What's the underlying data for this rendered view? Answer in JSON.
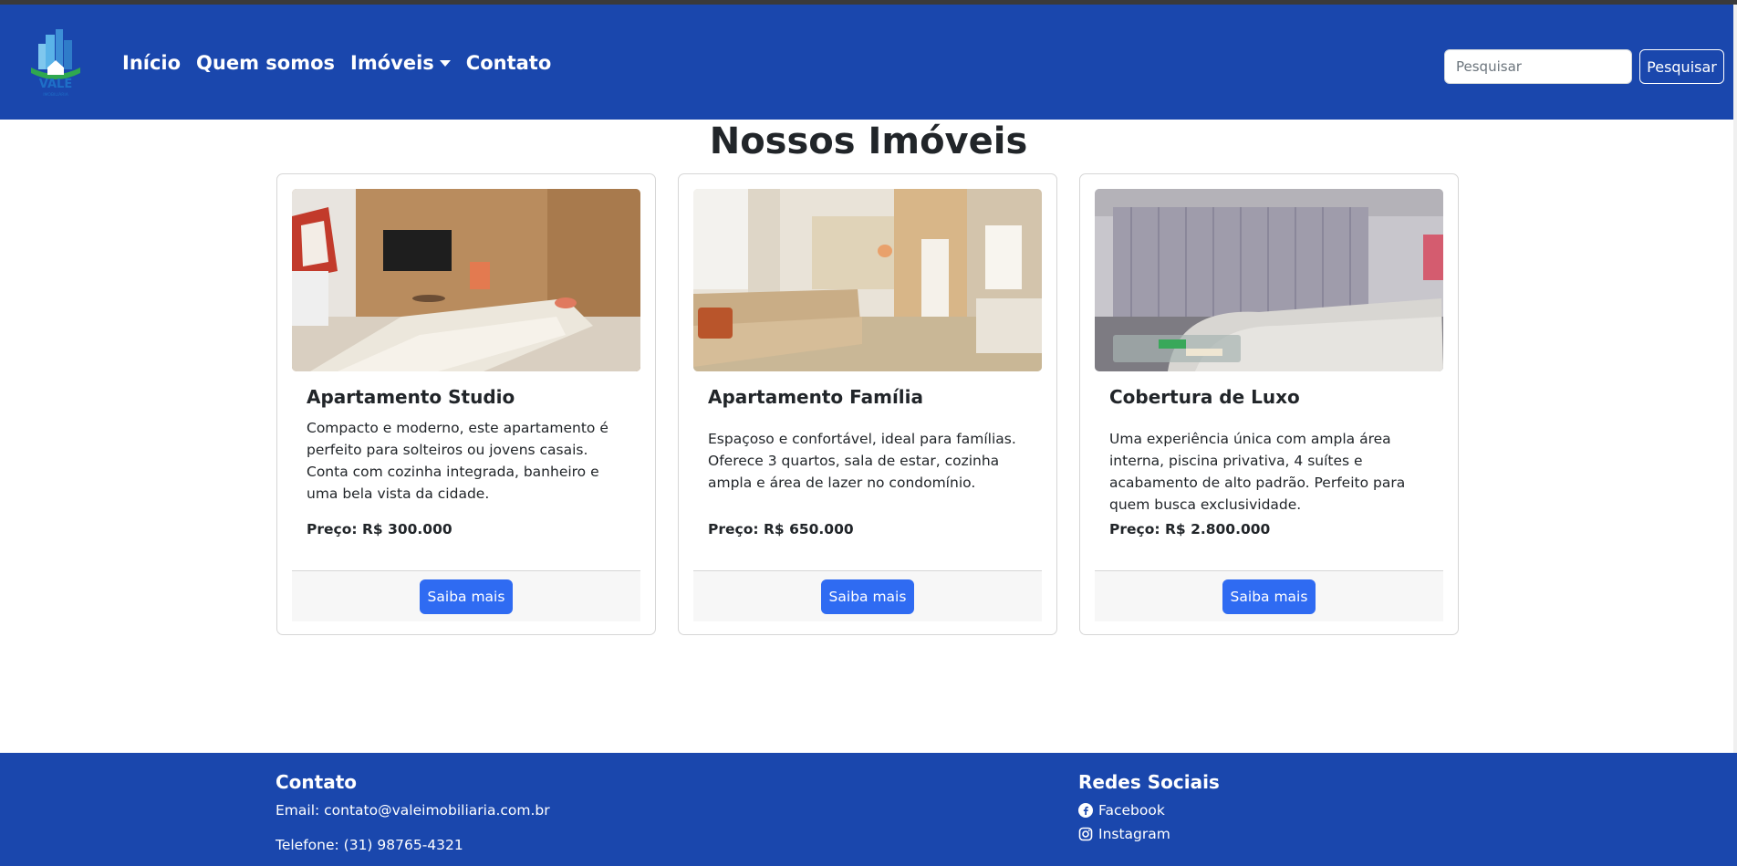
{
  "brand": {
    "name": "VALE",
    "sub": "IMOBILIÁRIA"
  },
  "nav": {
    "items": [
      {
        "label": "Início"
      },
      {
        "label": "Quem somos"
      },
      {
        "label": "Imóveis"
      },
      {
        "label": "Contato"
      }
    ]
  },
  "search": {
    "placeholder": "Pesquisar",
    "button_label": "Pesquisar"
  },
  "main": {
    "title": "Nossos Imóveis",
    "cards": [
      {
        "title": "Apartamento Studio",
        "description": "Compacto e moderno, este apartamento é perfeito para solteiros ou jovens casais. Conta com cozinha integrada, banheiro e uma bela vista da cidade.",
        "price": "Preço: R$ 300.000",
        "button_label": "Saiba mais"
      },
      {
        "title": "Apartamento Família",
        "description": "Espaçoso e confortável, ideal para famílias. Oferece 3 quartos, sala de estar, cozinha ampla e área de lazer no condomínio.",
        "price": "Preço: R$ 650.000",
        "button_label": "Saiba mais"
      },
      {
        "title": "Cobertura de Luxo",
        "description": "Uma experiência única com ampla área interna, piscina privativa, 4 suítes e acabamento de alto padrão. Perfeito para quem busca exclusividade.",
        "price": "Preço: R$ 2.800.000",
        "button_label": "Saiba mais"
      }
    ]
  },
  "footer": {
    "contact": {
      "heading": "Contato",
      "email": "Email: contato@valeimobiliaria.com.br",
      "phone": "Telefone: (31) 98765-4321"
    },
    "social": {
      "heading": "Redes Sociais",
      "facebook": "Facebook",
      "instagram": "Instagram"
    }
  },
  "colors": {
    "navbar": "#1a47ad",
    "primary_button": "#2f6bf2",
    "footer": "#1a47ad"
  }
}
